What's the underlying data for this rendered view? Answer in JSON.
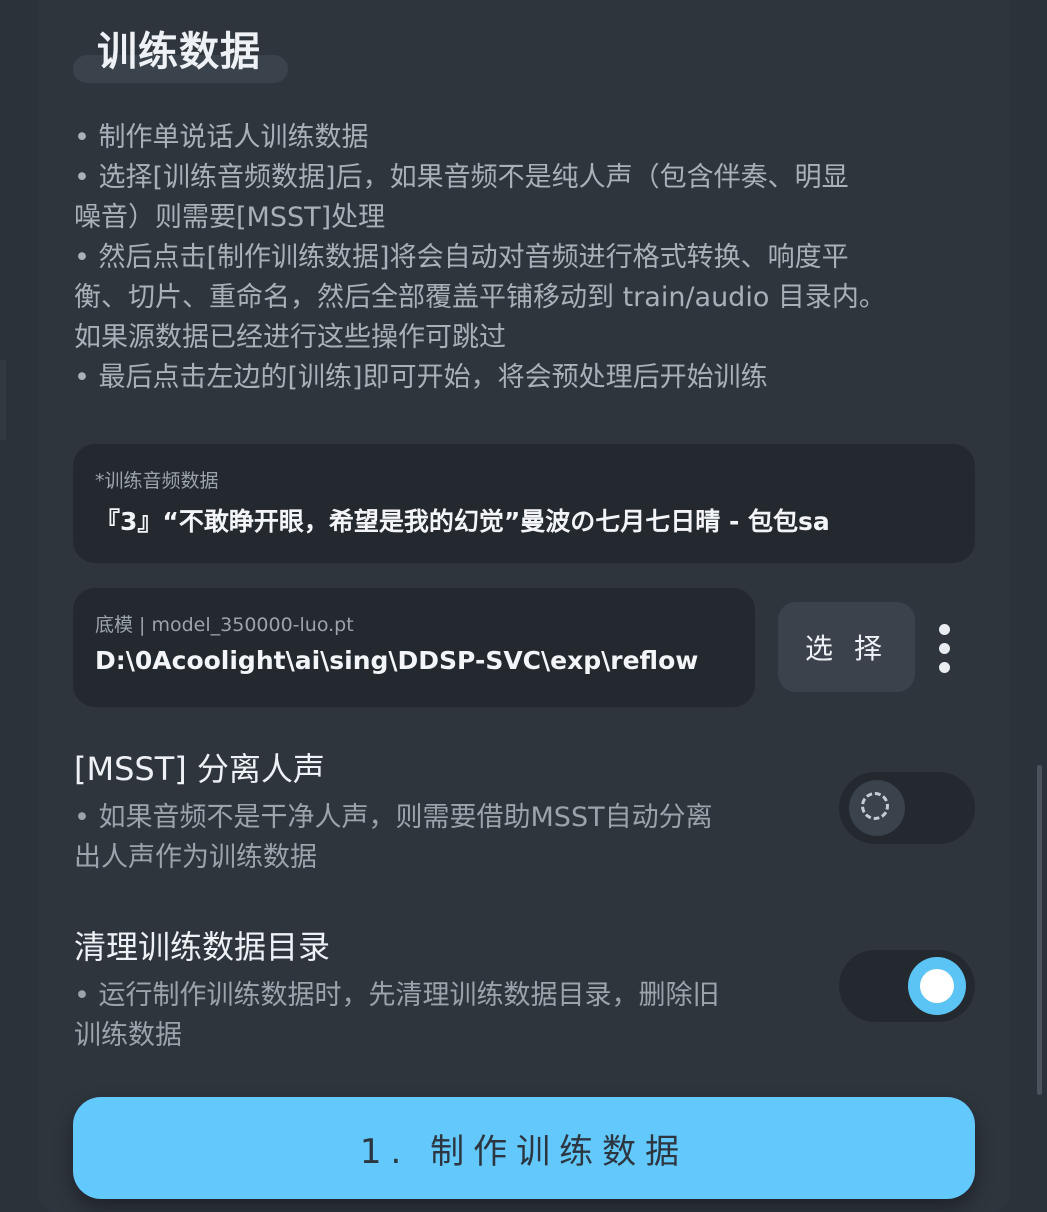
{
  "section": {
    "title": "训练数据"
  },
  "description": [
    "• 制作单说话人训练数据",
    "• 选择[训练音频数据]后，如果音频不是纯人声（包含伴奏、明显",
    "噪音）则需要[MSST]处理",
    "• 然后点击[制作训练数据]将会自动对音频进行格式转换、响度平",
    "衡、切片、重命名，然后全部覆盖平铺移动到 train/audio 目录内。",
    "如果源数据已经进行这些操作可跳过",
    "• 最后点击左边的[训练]即可开始，将会预处理后开始训练"
  ],
  "audio_field": {
    "label": "*训练音频数据",
    "value": "『3』“不敢睁开眼，希望是我的幻觉”曼波の七月七日晴 - 包包sa"
  },
  "model_field": {
    "label": "底模 | model_350000-luo.pt",
    "value": "D:\\0Acoolight\\ai\\sing\\DDSP-SVC\\exp\\reflow"
  },
  "select_button": {
    "label": "选 择"
  },
  "msst_option": {
    "title": "[MSST] 分离人声",
    "desc": [
      "• 如果音频不是干净人声，则需要借助MSST自动分离",
      "出人声作为训练数据"
    ],
    "enabled": false
  },
  "clean_option": {
    "title": "清理训练数据目录",
    "desc": [
      "• 运行制作训练数据时，先清理训练数据目录，删除旧",
      "训练数据"
    ],
    "enabled": true
  },
  "make_button": {
    "label": "1. 制作训练数据"
  },
  "colors": {
    "accent": "#63c8fb",
    "background": "#2b323a",
    "field": "#23292f"
  }
}
